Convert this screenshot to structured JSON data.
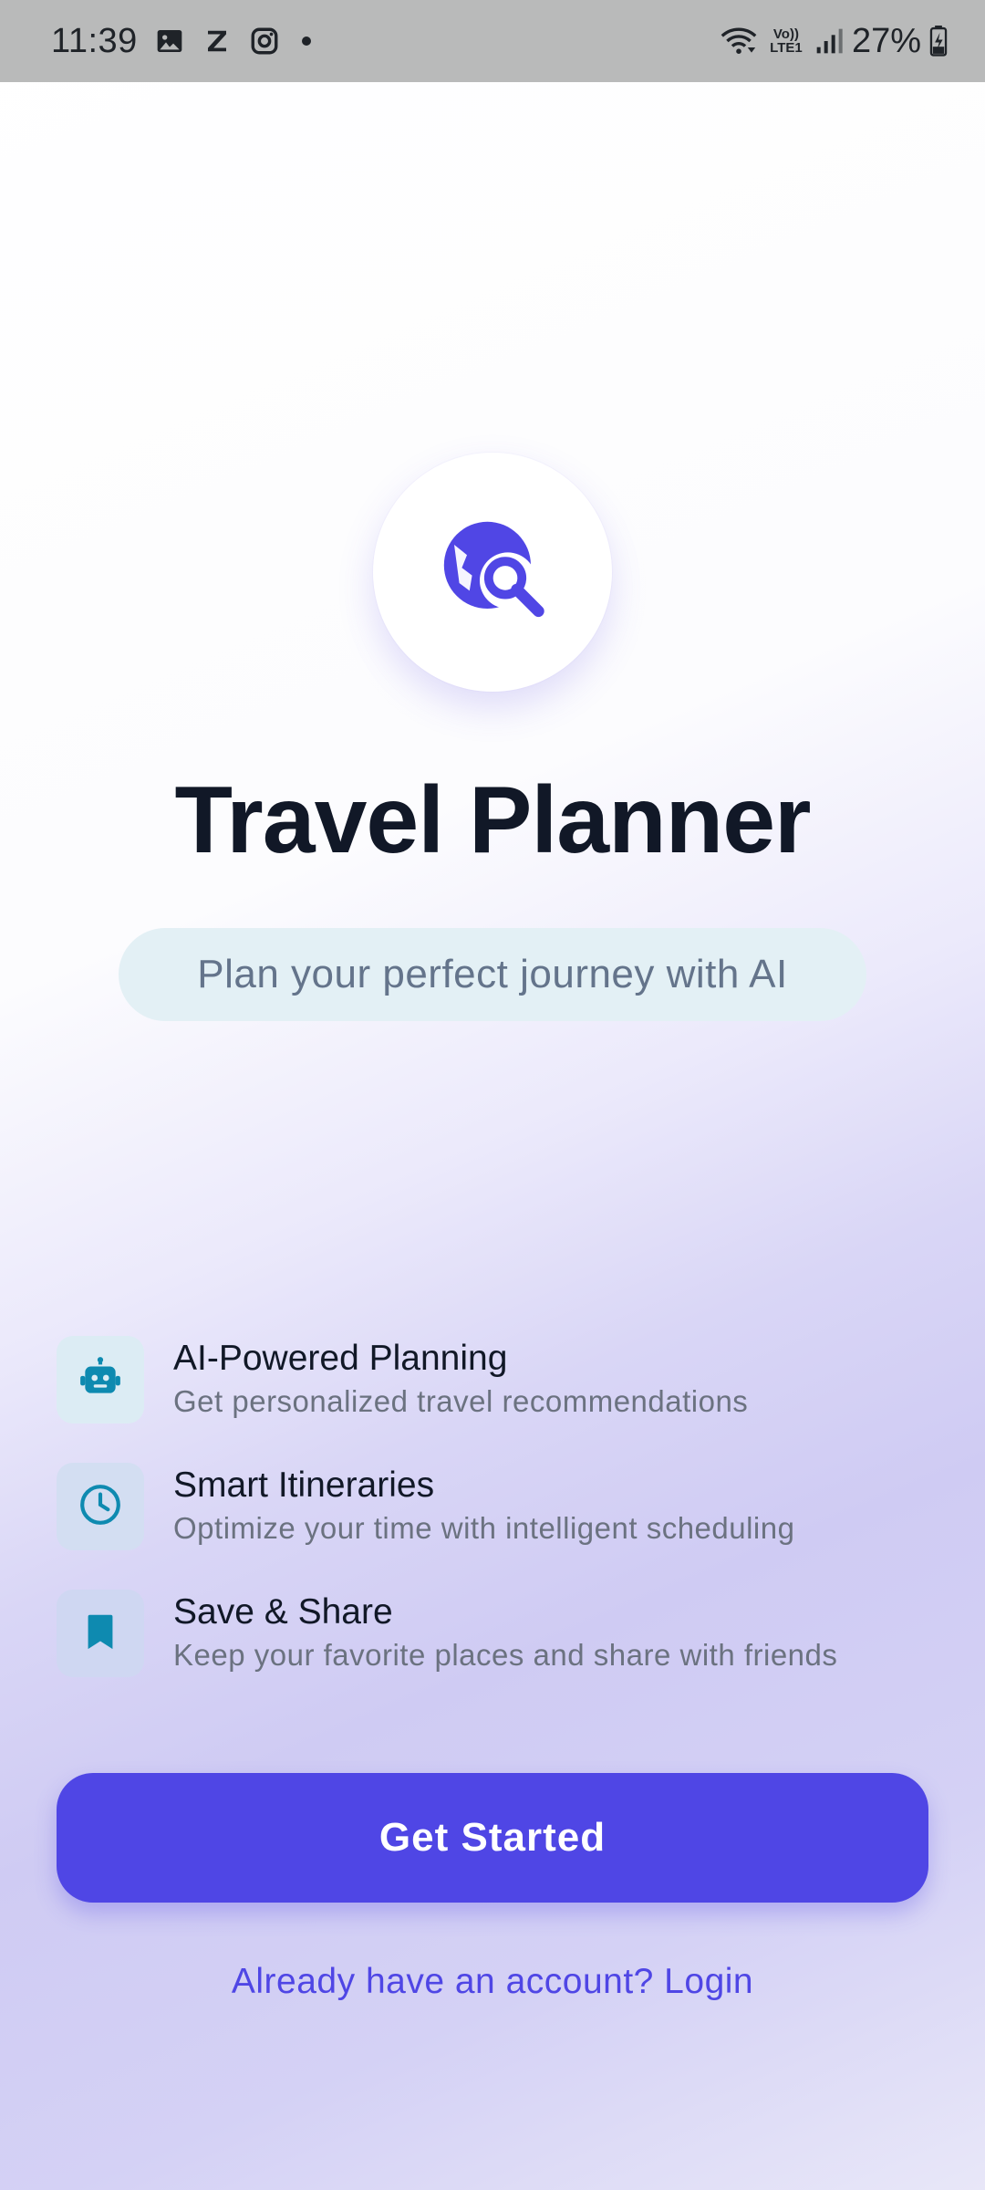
{
  "status_bar": {
    "time": "11:39",
    "battery": "27%",
    "network_label": "Vo)) LTE1",
    "icons": [
      "image-icon",
      "z-app-icon",
      "instagram-icon",
      "notification-dot",
      "wifi-icon",
      "volte-icon",
      "signal-icon",
      "battery-charging-icon"
    ]
  },
  "hero": {
    "logo_icon": "travel-explore-icon",
    "title": "Travel Planner",
    "tagline": "Plan your perfect journey with AI"
  },
  "features": [
    {
      "icon": "robot-icon",
      "title": "AI-Powered Planning",
      "description": "Get personalized travel recommendations"
    },
    {
      "icon": "clock-icon",
      "title": "Smart Itineraries",
      "description": "Optimize your time with intelligent scheduling"
    },
    {
      "icon": "bookmark-icon",
      "title": "Save & Share",
      "description": "Keep your favorite places and share with friends"
    }
  ],
  "actions": {
    "primary_label": "Get Started",
    "login_label": "Already have an account? Login"
  },
  "colors": {
    "primary": "#4f46e5",
    "feature_icon": "#0e8ab0",
    "title_text": "#111827",
    "muted_text": "#6b7280"
  }
}
